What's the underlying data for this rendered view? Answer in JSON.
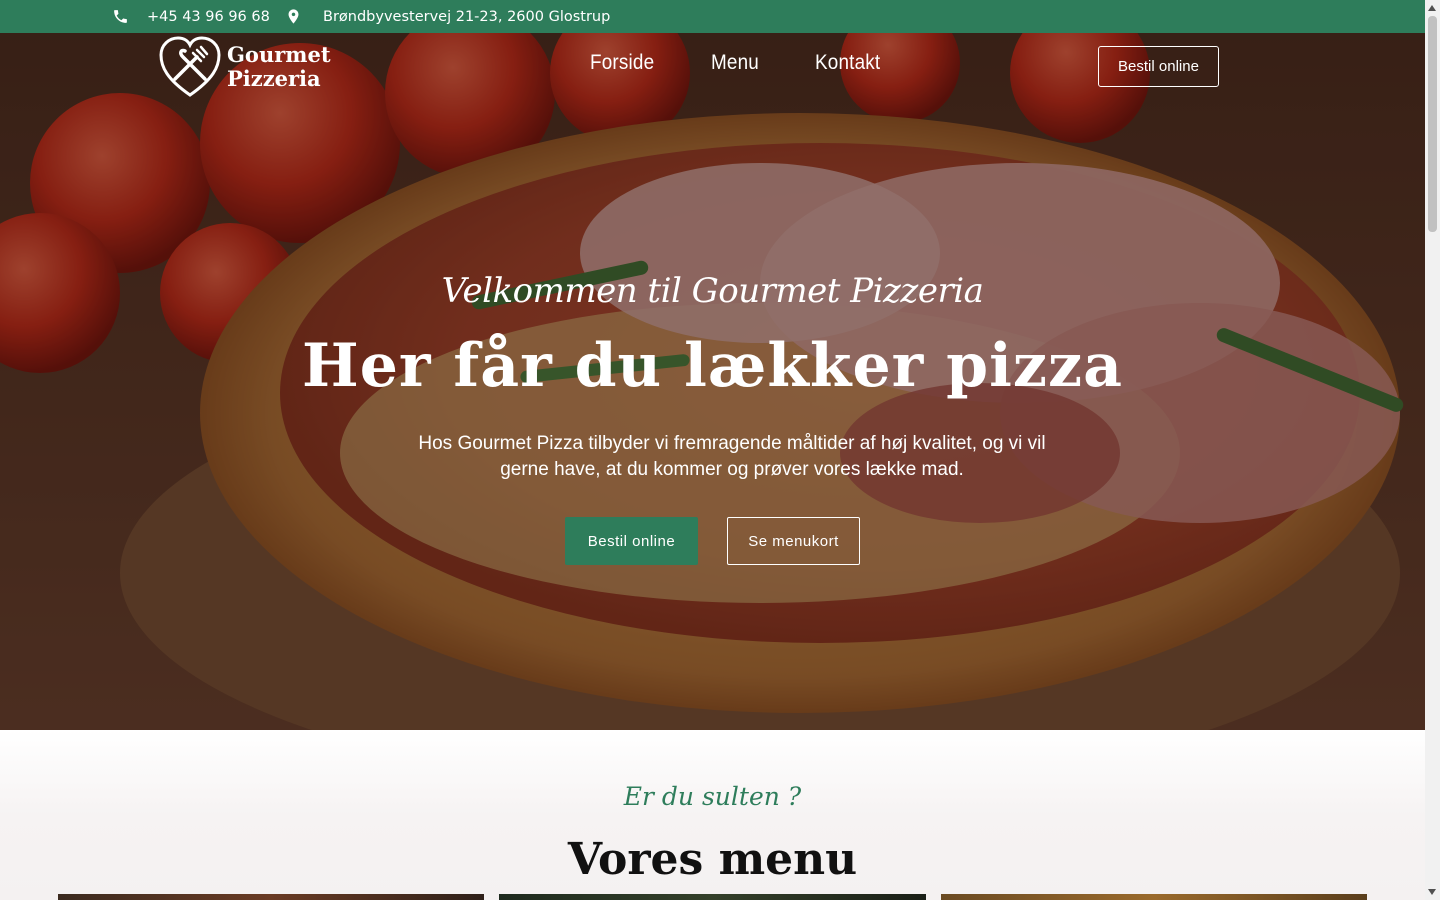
{
  "topbar": {
    "phone": "+45 43 96 96 68",
    "address": "Brøndbyvestervej 21-23, 2600 Glostrup",
    "phone_icon": "phone-icon",
    "address_icon": "map-pin-icon"
  },
  "header": {
    "logo_line1": "Gourmet",
    "logo_line2": "Pizzeria",
    "logo_icon": "fork-knife-heart-icon",
    "nav": [
      "Forside",
      "Menu",
      "Kontakt"
    ],
    "order_button": "Bestil online"
  },
  "hero": {
    "welcome": "Velkommen til Gourmet Pizzeria",
    "headline": "Her får du lækker pizza",
    "lead": "Hos Gourmet Pizza tilbyder vi fremragende måltider af høj kvalitet, og vi vil gerne have, at du kommer og prøver vores lække mad.",
    "cta_primary": "Bestil online",
    "cta_secondary": "Se menukort"
  },
  "menu_section": {
    "tagline": "Er du sulten ?",
    "title": "Vores menu"
  },
  "colors": {
    "brand_green": "#2e7d5b",
    "white": "#ffffff"
  }
}
